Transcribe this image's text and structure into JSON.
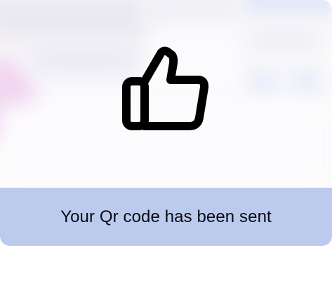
{
  "notification": {
    "message": "Your Qr code has been sent",
    "icon": "thumbs-up-icon",
    "banner_color": "#bccaee",
    "icon_color": "#000000"
  }
}
